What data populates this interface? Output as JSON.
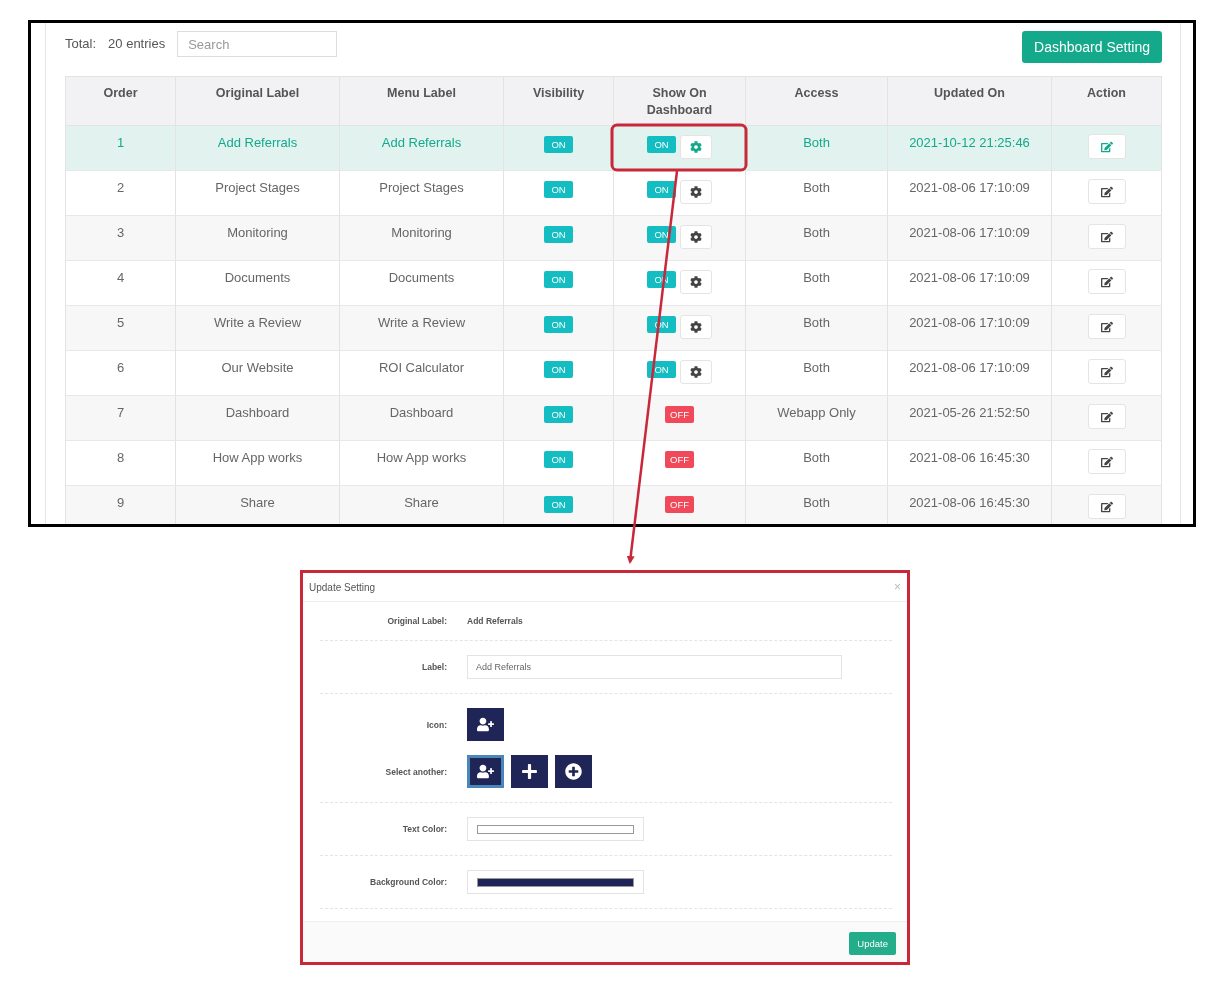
{
  "toolbar": {
    "total_label": "Total:",
    "total_value": "20 entries",
    "search": {
      "placeholder": "Search"
    },
    "button": "Dashboard Setting"
  },
  "table": {
    "columns": [
      "Order",
      "Original Label",
      "Menu Label",
      "Visibility",
      "Show On Dashboard",
      "Access",
      "Updated On",
      "Action"
    ],
    "rows": [
      {
        "order": "1",
        "original_label": "Add Referrals",
        "menu_label": "Add Referrals",
        "visibility": {
          "text": "ON",
          "on": true
        },
        "dashboard": {
          "text": "ON",
          "on": true
        },
        "access": "Both",
        "updated_on": "2021-10-12 21:25:46",
        "selected": true
      },
      {
        "order": "2",
        "original_label": "Project Stages",
        "menu_label": "Project Stages",
        "visibility": {
          "text": "ON",
          "on": true
        },
        "dashboard": {
          "text": "ON",
          "on": true
        },
        "access": "Both",
        "updated_on": "2021-08-06 17:10:09",
        "selected": false
      },
      {
        "order": "3",
        "original_label": "Monitoring",
        "menu_label": "Monitoring",
        "visibility": {
          "text": "ON",
          "on": true
        },
        "dashboard": {
          "text": "ON",
          "on": true
        },
        "access": "Both",
        "updated_on": "2021-08-06 17:10:09",
        "selected": false
      },
      {
        "order": "4",
        "original_label": "Documents",
        "menu_label": "Documents",
        "visibility": {
          "text": "ON",
          "on": true
        },
        "dashboard": {
          "text": "ON",
          "on": true
        },
        "access": "Both",
        "updated_on": "2021-08-06 17:10:09",
        "selected": false
      },
      {
        "order": "5",
        "original_label": "Write a Review",
        "menu_label": "Write a Review",
        "visibility": {
          "text": "ON",
          "on": true
        },
        "dashboard": {
          "text": "ON",
          "on": true
        },
        "access": "Both",
        "updated_on": "2021-08-06 17:10:09",
        "selected": false
      },
      {
        "order": "6",
        "original_label": "Our Website",
        "menu_label": "ROI Calculator",
        "visibility": {
          "text": "ON",
          "on": true
        },
        "dashboard": {
          "text": "ON",
          "on": true
        },
        "access": "Both",
        "updated_on": "2021-08-06 17:10:09",
        "selected": false
      },
      {
        "order": "7",
        "original_label": "Dashboard",
        "menu_label": "Dashboard",
        "visibility": {
          "text": "ON",
          "on": true
        },
        "dashboard": {
          "text": "OFF",
          "on": false
        },
        "access": "Webapp Only",
        "updated_on": "2021-05-26 21:52:50",
        "selected": false
      },
      {
        "order": "8",
        "original_label": "How App works",
        "menu_label": "How App works",
        "visibility": {
          "text": "ON",
          "on": true
        },
        "dashboard": {
          "text": "OFF",
          "on": false
        },
        "access": "Both",
        "updated_on": "2021-08-06 16:45:30",
        "selected": false
      },
      {
        "order": "9",
        "original_label": "Share",
        "menu_label": "Share",
        "visibility": {
          "text": "ON",
          "on": true
        },
        "dashboard": {
          "text": "OFF",
          "on": false
        },
        "access": "Both",
        "updated_on": "2021-08-06 16:45:30",
        "selected": false
      }
    ]
  },
  "modal": {
    "title": "Update Setting",
    "close": "×",
    "fields": [
      {
        "kind": "text",
        "label": "Original Label:",
        "value": "Add Referrals"
      },
      {
        "kind": "input",
        "label": "Label:",
        "value": "Add Referrals"
      },
      {
        "kind": "icons",
        "label": "Icon:",
        "label2": "Select another:",
        "choices": [
          {
            "selected": true
          },
          {
            "selected": false
          },
          {
            "selected": false
          }
        ]
      },
      {
        "kind": "color",
        "label": "Text Color:",
        "color": "#ffffff"
      },
      {
        "kind": "color",
        "label": "Background Color:",
        "color": "#1f2557"
      }
    ],
    "button": "Update"
  }
}
